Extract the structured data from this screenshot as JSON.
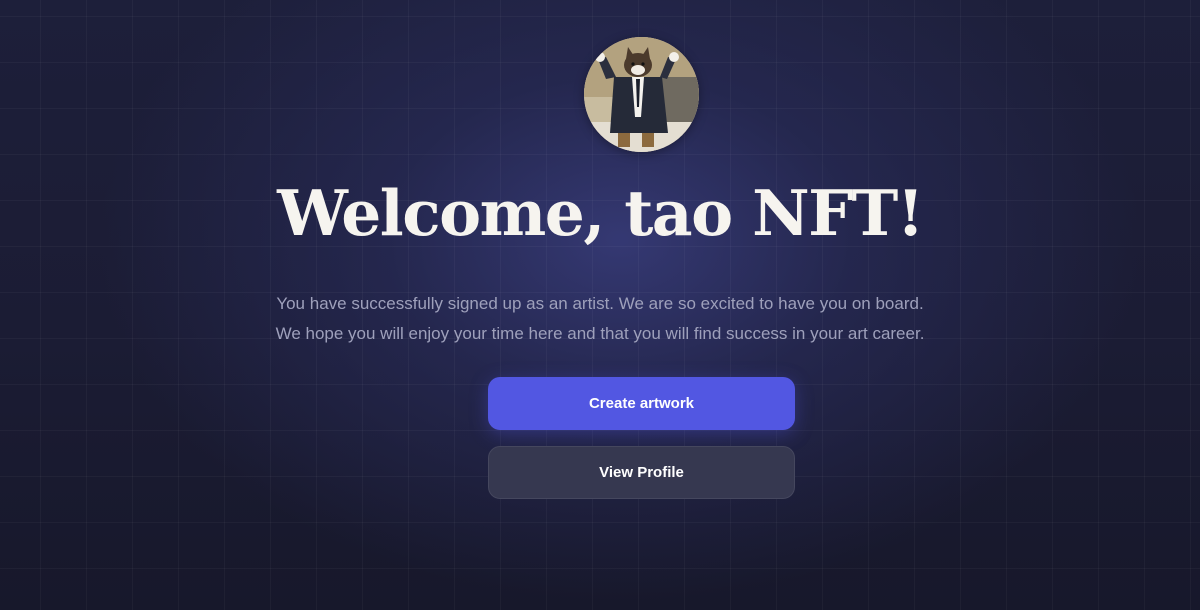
{
  "welcome": {
    "title": "Welcome, tao NFT!",
    "message_line1": "You have successfully signed up as an artist. We are so excited to have you on board.",
    "message_line2": "We hope you will enjoy your time here and that you will find success in your art career."
  },
  "actions": {
    "create_artwork_label": "Create artwork",
    "view_profile_label": "View Profile"
  },
  "colors": {
    "background": "#1a1b31",
    "primary_button": "#5257e2",
    "secondary_button": "#363850",
    "title_text": "#f6f4ef",
    "body_text": "#9ea0bb"
  },
  "icons": {
    "avatar": "profile-avatar-cat-in-suit"
  }
}
